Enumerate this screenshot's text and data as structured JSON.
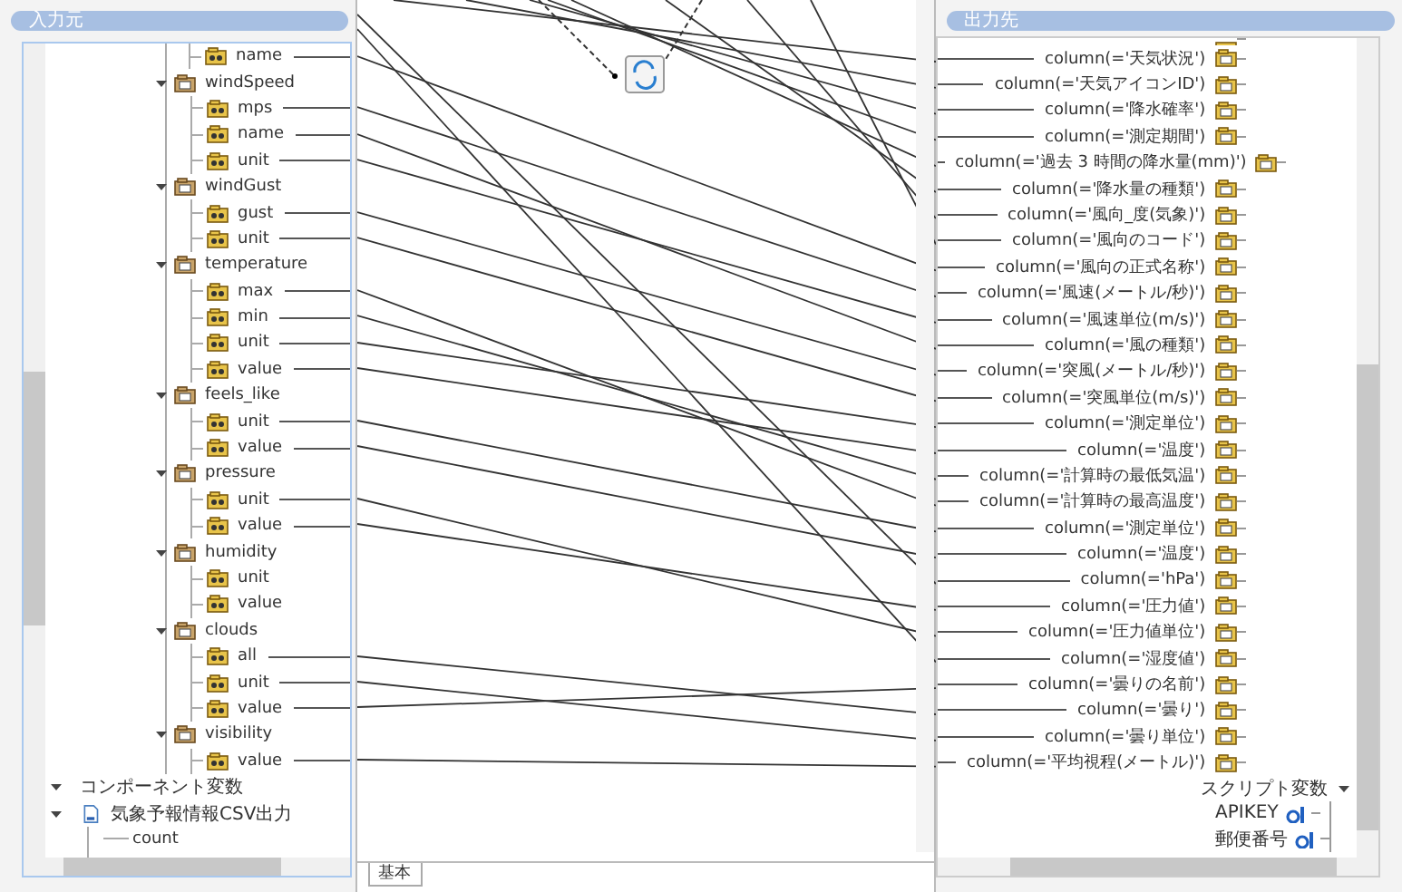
{
  "input_panel": {
    "title": "入力元",
    "tree": [
      {
        "label": "name",
        "kind": "field",
        "mapped": true
      },
      {
        "label": "windSpeed",
        "kind": "group",
        "expanded": true,
        "children": [
          {
            "label": "mps",
            "mapped": true
          },
          {
            "label": "name",
            "mapped": true
          },
          {
            "label": "unit",
            "mapped": true
          }
        ]
      },
      {
        "label": "windGust",
        "kind": "group",
        "expanded": true,
        "children": [
          {
            "label": "gust",
            "mapped": true
          },
          {
            "label": "unit",
            "mapped": true
          }
        ]
      },
      {
        "label": "temperature",
        "kind": "group",
        "expanded": true,
        "children": [
          {
            "label": "max",
            "mapped": true
          },
          {
            "label": "min",
            "mapped": true
          },
          {
            "label": "unit",
            "mapped": true
          },
          {
            "label": "value",
            "mapped": true
          }
        ]
      },
      {
        "label": "feels_like",
        "kind": "group",
        "expanded": true,
        "children": [
          {
            "label": "unit",
            "mapped": true
          },
          {
            "label": "value",
            "mapped": true
          }
        ]
      },
      {
        "label": "pressure",
        "kind": "group",
        "expanded": true,
        "children": [
          {
            "label": "unit",
            "mapped": true
          },
          {
            "label": "value",
            "mapped": true
          }
        ]
      },
      {
        "label": "humidity",
        "kind": "group",
        "expanded": true,
        "children": [
          {
            "label": "unit",
            "mapped": false
          },
          {
            "label": "value",
            "mapped": false
          }
        ]
      },
      {
        "label": "clouds",
        "kind": "group",
        "expanded": true,
        "children": [
          {
            "label": "all",
            "mapped": true
          },
          {
            "label": "unit",
            "mapped": true
          },
          {
            "label": "value",
            "mapped": true
          }
        ]
      },
      {
        "label": "visibility",
        "kind": "group",
        "expanded": true,
        "children": [
          {
            "label": "value",
            "mapped": true
          }
        ]
      }
    ],
    "component_variables": {
      "label": "コンポーネント変数",
      "expanded": true,
      "children": [
        {
          "label": "気象予報情報CSV出力",
          "expanded": true,
          "children": [
            {
              "label": "count"
            }
          ]
        }
      ]
    }
  },
  "mapping_area": {
    "tabs": [
      {
        "label": "基本",
        "selected": true
      }
    ]
  },
  "output_panel": {
    "title": "出力先",
    "columns": [
      "column(='天気状況')",
      "column(='天気アイコンID')",
      "column(='降水確率')",
      "column(='測定期間')",
      "column(='過去 3 時間の降水量(mm)')",
      "column(='降水量の種類')",
      "column(='風向_度(気象)')",
      "column(='風向のコード')",
      "column(='風向の正式名称')",
      "column(='風速(メートル/秒)')",
      "column(='風速単位(m/s)')",
      "column(='風の種類')",
      "column(='突風(メートル/秒)')",
      "column(='突風単位(m/s)')",
      "column(='測定単位')",
      "column(='温度')",
      "column(='計算時の最低気温')",
      "column(='計算時の最高温度')",
      "column(='測定単位')",
      "column(='温度')",
      "column(='hPa')",
      "column(='圧力値')",
      "column(='圧力値単位')",
      "column(='湿度値')",
      "column(='曇りの名前')",
      "column(='曇り')",
      "column(='曇り単位')",
      "column(='平均視程(メートル)')"
    ],
    "script_variables": {
      "label": "スクリプト変数",
      "expanded": true,
      "children": [
        "APIKEY",
        "郵便番号"
      ]
    }
  }
}
